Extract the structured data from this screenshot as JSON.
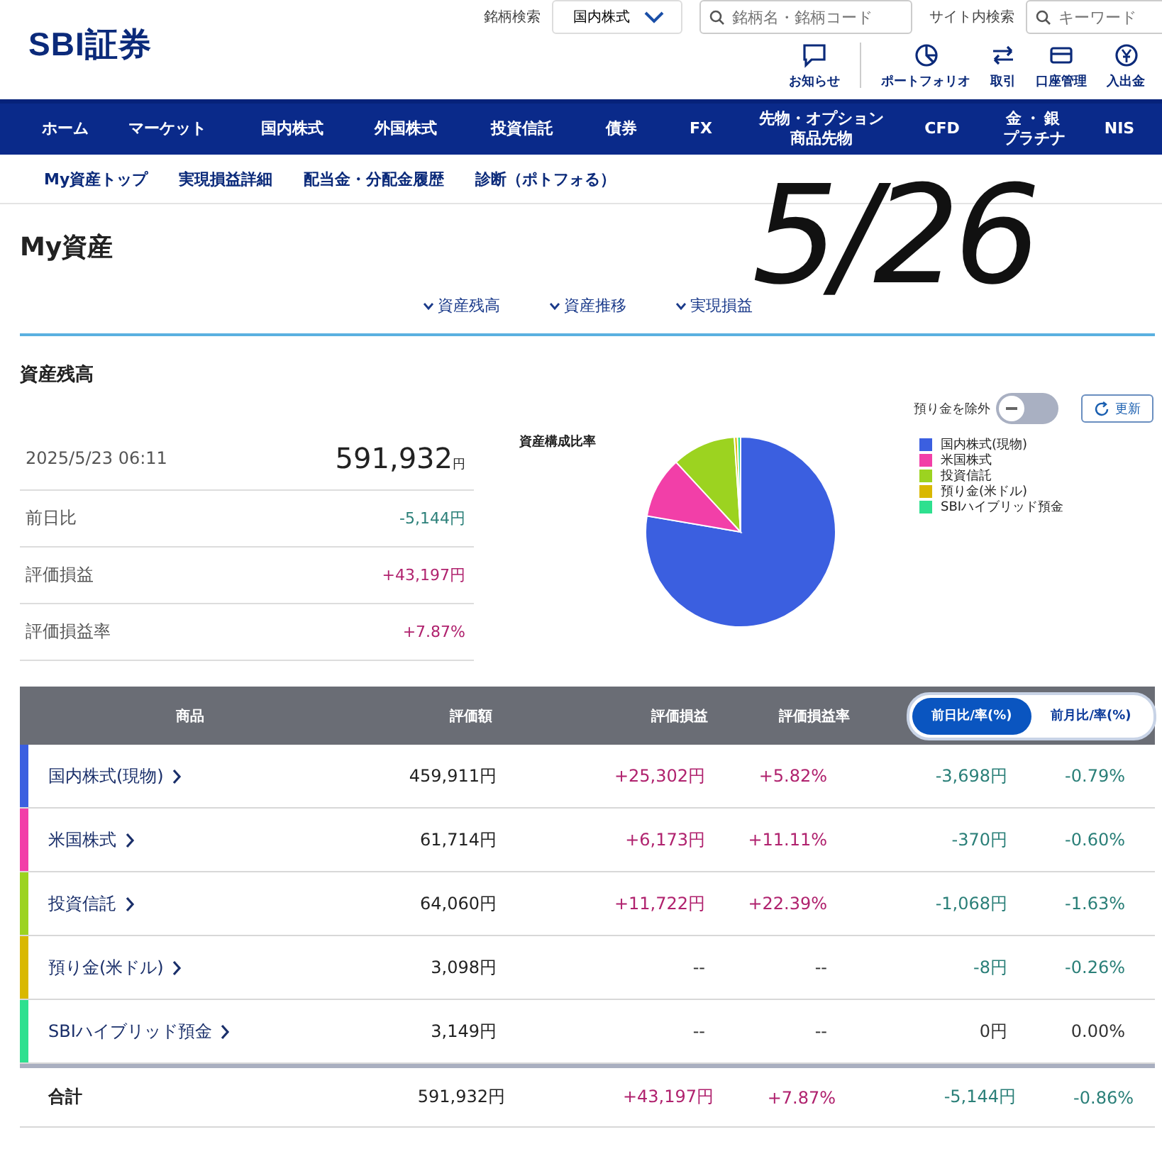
{
  "header": {
    "logo": "SBI証券",
    "stock_search": {
      "label": "銘柄検索",
      "market": "国内株式",
      "placeholder": "銘柄名・銘柄コード"
    },
    "site_search": {
      "label": "サイト内検索",
      "placeholder": "キーワード"
    },
    "shortcuts": [
      {
        "label": "お知らせ",
        "kind": "bubble"
      },
      {
        "label": "ポートフォリオ",
        "kind": "pie"
      },
      {
        "label": "取引",
        "kind": "arrows"
      },
      {
        "label": "口座管理",
        "kind": "card"
      },
      {
        "label": "入出金",
        "kind": "yen"
      }
    ]
  },
  "main_nav": [
    "ホーム",
    "マーケット",
    "国内株式",
    "外国株式",
    "投資信託",
    "債券",
    "FX",
    "先物・オプション商品先物",
    "CFD",
    "金・銀プラチナ",
    "NIS"
  ],
  "sub_nav": [
    "My資産トップ",
    "実現損益詳細",
    "配当金・分配金履歴",
    "診断（ポトフォる）"
  ],
  "handwritten_note": "5/26",
  "page_title": "My資産",
  "anchors": [
    "資産残高",
    "資産推移",
    "実現損益"
  ],
  "section_title": "資産残高",
  "exclude_deposits": {
    "label": "預り金を除外",
    "on": false
  },
  "refresh_button": "更新",
  "summary": {
    "timestamp": "2025/5/23 06:11",
    "total": "591,932",
    "currency": "円",
    "rows": [
      {
        "label": "前日比",
        "value": "-5,144円",
        "color": "#2a7f78"
      },
      {
        "label": "評価損益",
        "value": "+43,197円",
        "color": "#b0226e"
      },
      {
        "label": "評価損益率",
        "value": "+7.87%",
        "color": "#b0226e"
      }
    ]
  },
  "chart_data": {
    "type": "pie",
    "title": "資産構成比率",
    "legend": "right",
    "categories": [
      "国内株式(現物)",
      "米国株式",
      "投資信託",
      "預り金(米ドル)",
      "SBIハイブリッド預金"
    ],
    "series": [
      {
        "colors": [
          "#3b5fe0",
          "#f23fa8",
          "#9cd320",
          "#d9b800",
          "#2ee08f"
        ],
        "values": [
          77.7,
          10.43,
          10.82,
          0.52,
          0.53
        ]
      }
    ]
  },
  "table": {
    "columns": [
      "商品",
      "評価額",
      "評価損益",
      "評価損益率"
    ],
    "compare_tabs": [
      {
        "label": "前日比/率(%)",
        "selected": true
      },
      {
        "label": "前月比/率(%)",
        "selected": false
      }
    ],
    "rows": [
      {
        "name": "国内株式(現物)",
        "color": "#3b5fe0",
        "value": "459,911円",
        "pl": {
          "text": "+25,302円",
          "color": "#b0226e"
        },
        "pl_rate": {
          "text": "+5.82%",
          "color": "#b0226e"
        },
        "change": {
          "text": "-3,698円",
          "color": "#2a7f78"
        },
        "change_rate": {
          "text": "-0.79%",
          "color": "#2a7f78"
        }
      },
      {
        "name": "米国株式",
        "color": "#f23fa8",
        "value": "61,714円",
        "pl": {
          "text": "+6,173円",
          "color": "#b0226e"
        },
        "pl_rate": {
          "text": "+11.11%",
          "color": "#b0226e"
        },
        "change": {
          "text": "-370円",
          "color": "#2a7f78"
        },
        "change_rate": {
          "text": "-0.60%",
          "color": "#2a7f78"
        }
      },
      {
        "name": "投資信託",
        "color": "#9cd320",
        "value": "64,060円",
        "pl": {
          "text": "+11,722円",
          "color": "#b0226e"
        },
        "pl_rate": {
          "text": "+22.39%",
          "color": "#b0226e"
        },
        "change": {
          "text": "-1,068円",
          "color": "#2a7f78"
        },
        "change_rate": {
          "text": "-1.63%",
          "color": "#2a7f78"
        }
      },
      {
        "name": "預り金(米ドル)",
        "color": "#d9b800",
        "value": "3,098円",
        "pl": {
          "text": "--",
          "color": "#333333"
        },
        "pl_rate": {
          "text": "--",
          "color": "#333333"
        },
        "change": {
          "text": "-8円",
          "color": "#2a7f78"
        },
        "change_rate": {
          "text": "-0.26%",
          "color": "#2a7f78"
        }
      },
      {
        "name": "SBIハイブリッド預金",
        "color": "#2ee08f",
        "value": "3,149円",
        "pl": {
          "text": "--",
          "color": "#333333"
        },
        "pl_rate": {
          "text": "--",
          "color": "#333333"
        },
        "change": {
          "text": "0円",
          "color": "#333333"
        },
        "change_rate": {
          "text": "0.00%",
          "color": "#333333"
        }
      }
    ],
    "total": {
      "name": "合計",
      "value": "591,932円",
      "pl": {
        "text": "+43,197円",
        "color": "#b0226e"
      },
      "pl_rate": {
        "text": "+7.87%",
        "color": "#b0226e"
      },
      "change": {
        "text": "-5,144円",
        "color": "#2a7f78"
      },
      "change_rate": {
        "text": "-0.86%",
        "color": "#2a7f78"
      }
    }
  }
}
